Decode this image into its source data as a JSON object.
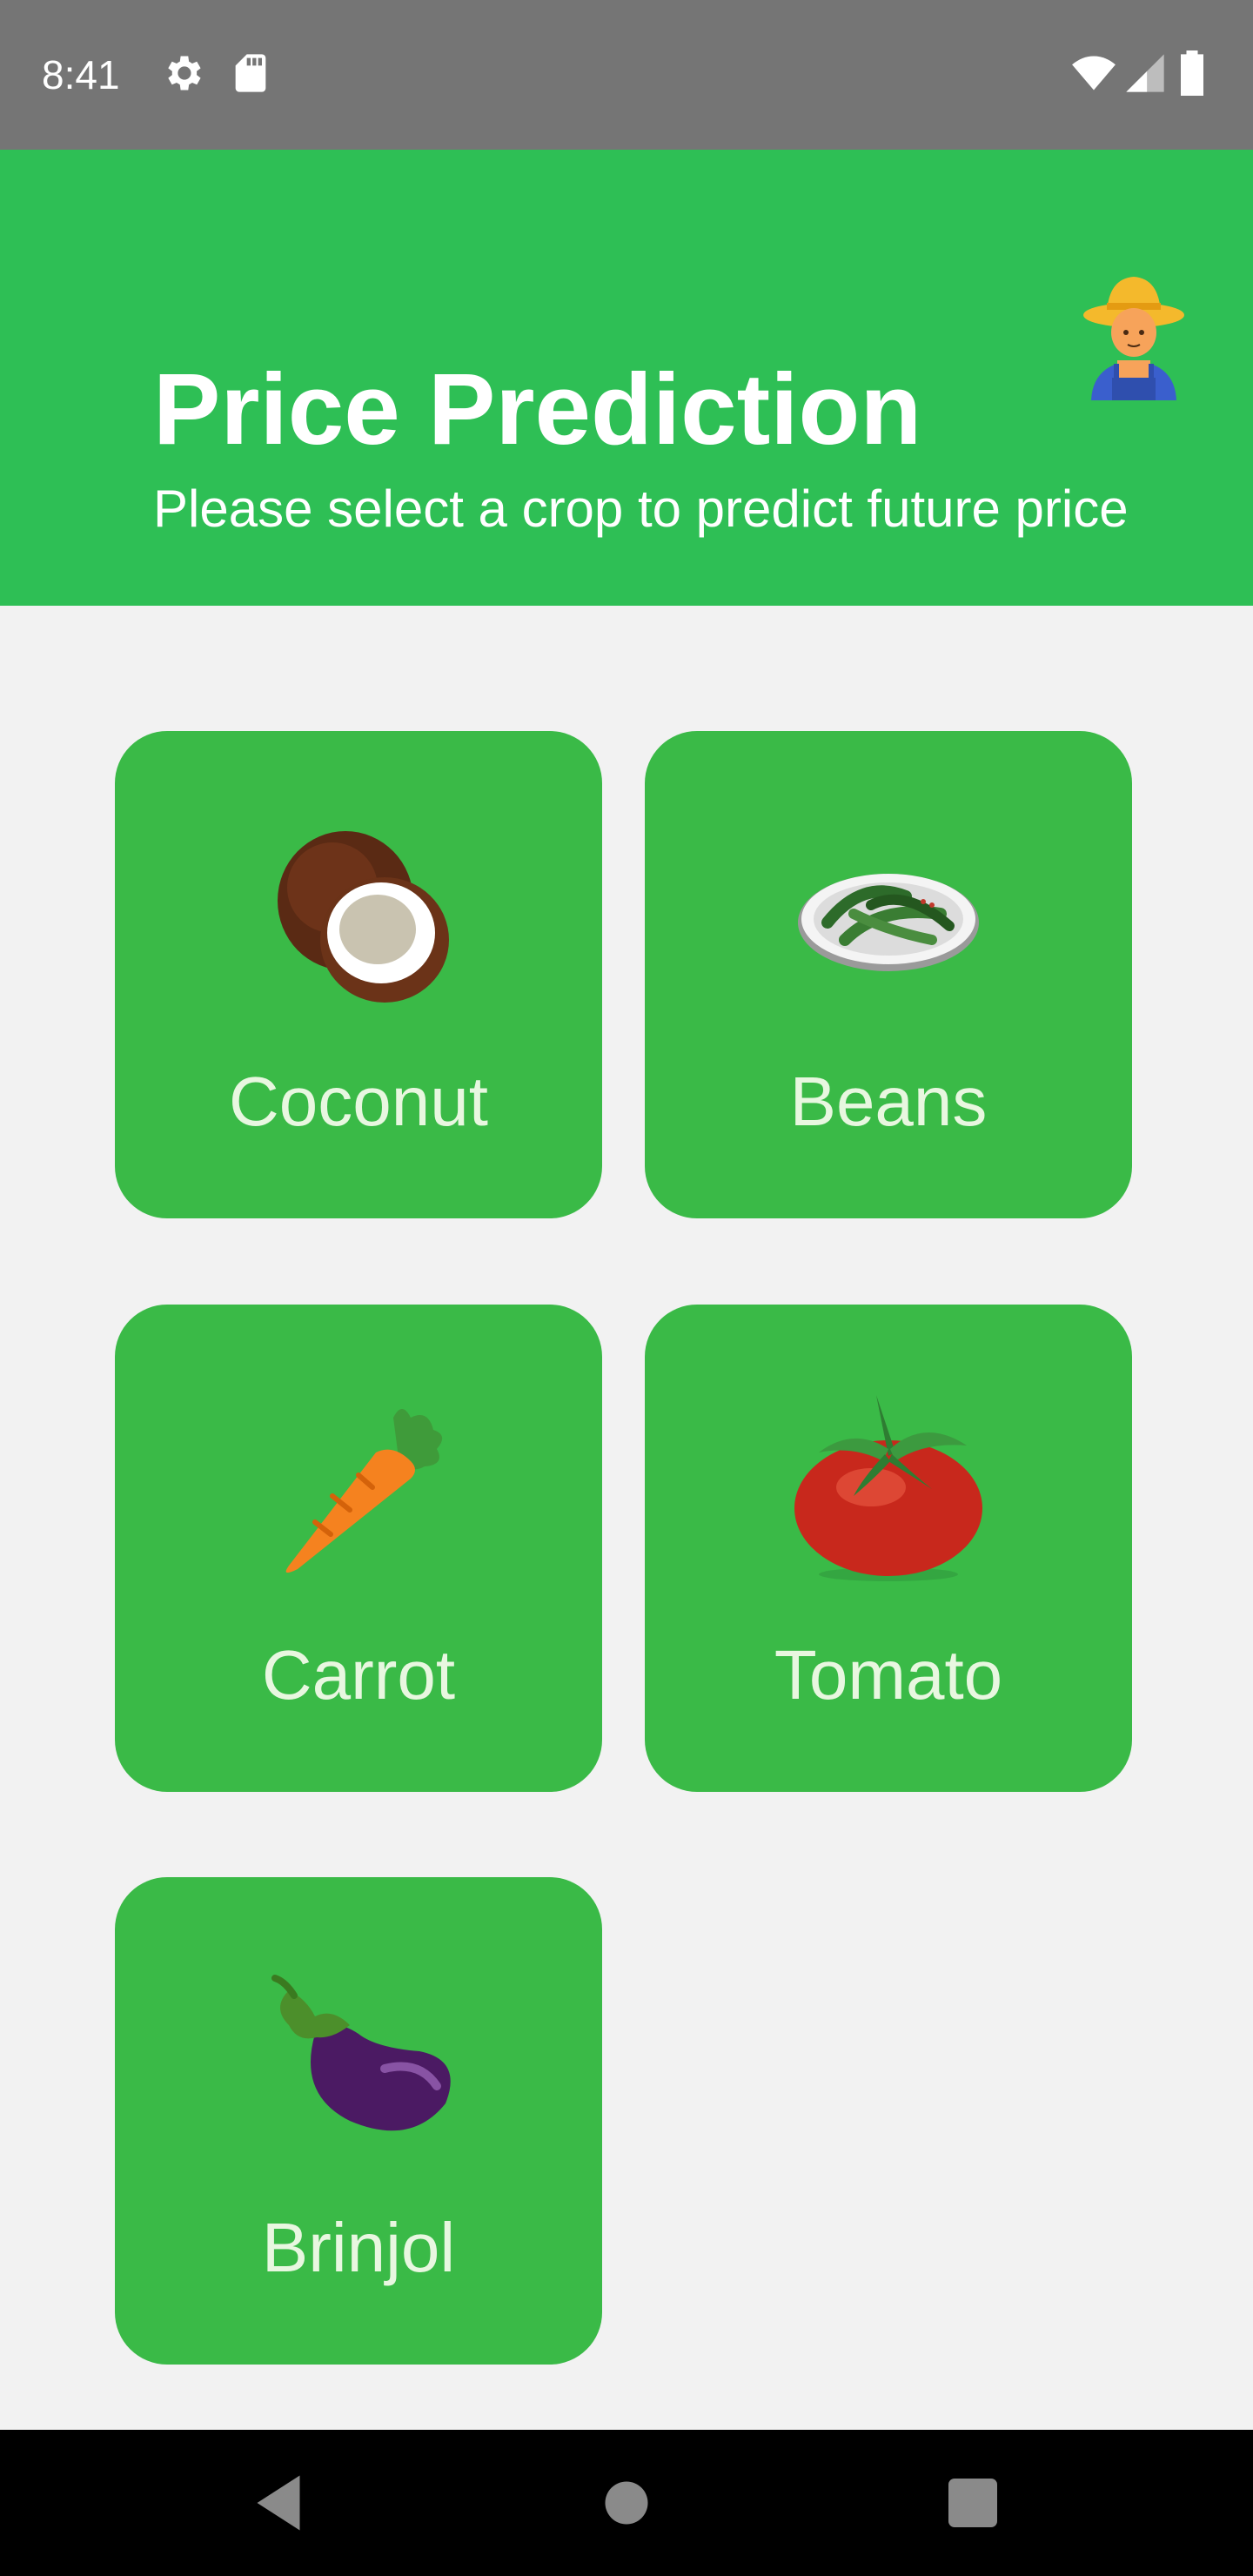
{
  "status_bar": {
    "time": "8:41",
    "icons": [
      "gear-icon",
      "sd-card-icon",
      "wifi-icon",
      "signal-icon",
      "battery-icon"
    ]
  },
  "header": {
    "title": "Price Prediction",
    "subtitle": "Please select a crop to predict future price",
    "avatar_icon": "farmer-icon",
    "background_color": "#2ebf55"
  },
  "crops": [
    {
      "label": "Coconut",
      "icon": "coconut-icon"
    },
    {
      "label": "Beans",
      "icon": "beans-icon"
    },
    {
      "label": "Carrot",
      "icon": "carrot-icon"
    },
    {
      "label": "Tomato",
      "icon": "tomato-icon"
    },
    {
      "label": "Brinjol",
      "icon": "eggplant-icon"
    }
  ],
  "card_color": "#3aba47",
  "nav_bar": {
    "buttons": [
      "back-icon",
      "home-icon",
      "recents-icon"
    ]
  }
}
